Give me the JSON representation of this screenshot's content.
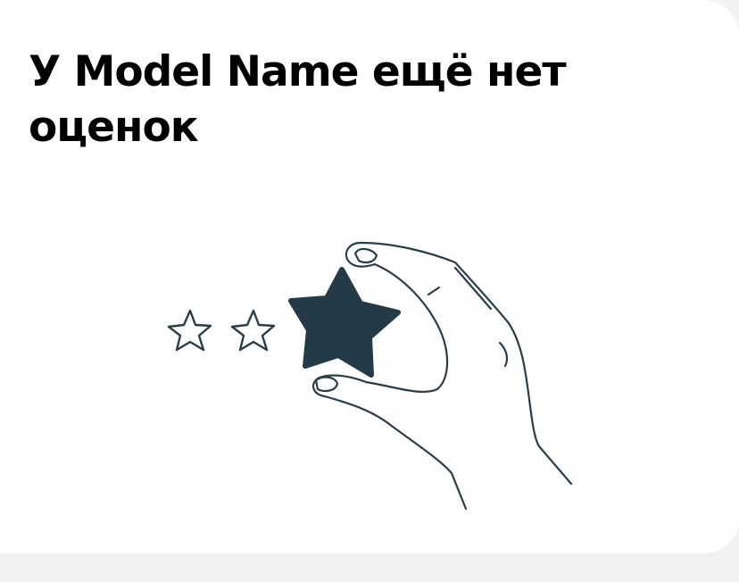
{
  "empty_state": {
    "title": "У Model Name ещё нет оценок",
    "illustration_icon": "hand-holding-star-icon"
  },
  "colors": {
    "page_background": "#f2f2f5",
    "card_background": "#ffffff",
    "title_text": "#000000",
    "illustration_stroke": "#2b3d48",
    "star_fill": "#243a47"
  }
}
